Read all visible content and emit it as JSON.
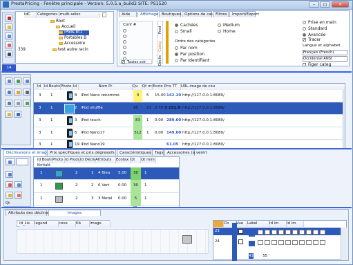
{
  "window": {
    "title": "PrestaPricing - Fenêtre principale - Version: 5.0.5.a_build2 SITE: PS1520"
  },
  "top_left": {
    "category_headers": [
      "IdC",
      "Catégories (multi-sélec"
    ],
    "category_rows": [
      {
        "id": "",
        "label": "Root"
      },
      {
        "id": "",
        "label": "Accueil"
      },
      {
        "id": "",
        "label": "iPods bt1"
      },
      {
        "id": "",
        "label": "Portables B"
      },
      {
        "id": "",
        "label": "Accessoire"
      },
      {
        "id": "339",
        "label": "test autre racin"
      }
    ],
    "number_label": "14"
  },
  "options": {
    "tabs": [
      "Aide",
      "Affichage",
      "Boutiques",
      "Options de calcul",
      "Filtres",
      "Import/Export"
    ],
    "conf_title": "Conf #",
    "conf_radio_count": 6,
    "side_tabs": [
      "Prod",
      "Catég",
      "Déclis"
    ],
    "size_options": [
      "Cachées",
      "Medium",
      "Small",
      "Home"
    ],
    "order_title": "Ordre des catégories",
    "order_options": [
      "Par nom",
      "Par position",
      "Par Identifiant"
    ],
    "mode_options": [
      "Prise en main",
      "Standard",
      "Avancée"
    ],
    "tracer_label": "Tracer",
    "language_title": "Langue et alphabet",
    "language_value": "Français (French)",
    "alphabet_value": "Occidental ANSI",
    "freeze_label": "Figer categ",
    "tout_label": "Toutes voir"
  },
  "products": {
    "headers": [
      "Id",
      "Id Boutiq",
      "Photo",
      "Id I",
      "Nom Pr",
      "Qu",
      "Qt mi",
      "Ecots",
      "Prix TT",
      "URL image de cou"
    ],
    "rows": [
      {
        "id": "3",
        "shop": "1",
        "idI": "8",
        "name": "iPod Nano renommé",
        "qty": "0",
        "qty_min": "5",
        "eco": "15.00",
        "price": "142.20",
        "url": "http://127.0.0.1:8080/"
      },
      {
        "id": "3",
        "shop": "1",
        "idI": "2",
        "name": "iPod shuffle",
        "qty": "95",
        "qty_min": "27",
        "eco": "2.70",
        "price": "3 231.9",
        "url": "http://127.0.0.1:8080/"
      },
      {
        "id": "3",
        "shop": "1",
        "idI": "3",
        "name": "iPod touch",
        "qty": "83",
        "qty_min": "1",
        "eco": "0.00",
        "price": "289.00",
        "url": "http://127.0.0.1:8080/"
      },
      {
        "id": "3",
        "shop": "1",
        "idI": "6",
        "name": "iPod Nano17",
        "qty": "512",
        "qty_min": "1",
        "eco": "0.00",
        "price": "149.00",
        "url": "http://127.0.0.1:8080/"
      },
      {
        "id": "3",
        "shop": "1",
        "idI": "19",
        "name": "iPod Nano19",
        "qty": "",
        "qty_min": "",
        "eco": "",
        "price": "61.05",
        "url": "http://127.0.0.1:8080/"
      }
    ]
  },
  "declinaisons": {
    "tabs": [
      "Déclinaisons et images",
      "Prix spécifiques et prix dégressifs",
      "Caractéristiques",
      "Tags",
      "Accessoires (à venir)"
    ],
    "headers": [
      "Id Boutique",
      "Photo",
      "Id Produit",
      "Id Déclin",
      "Attributs",
      "Ecotax",
      "Qt",
      "Qt mini"
    ],
    "header_note": "Kontakt",
    "rows": [
      {
        "shop": "1",
        "product": "2",
        "declin": "1",
        "attr": "4 Bleu",
        "eco": "5.00",
        "qty": "30",
        "min": "1"
      },
      {
        "shop": "1",
        "product": "2",
        "declin": "2",
        "attr": "6 Vert",
        "eco": "0.00",
        "qty": "30",
        "min": "1"
      },
      {
        "shop": "1",
        "product": "2",
        "declin": "3",
        "attr": "3 Metal",
        "eco": "0.00",
        "qty": "5",
        "min": "1"
      }
    ],
    "total_qty": "95",
    "qt_label": "Qt"
  },
  "bottom": {
    "tabs": [
      "Attributs des déclinaisons",
      "Images"
    ],
    "headers": [
      "Id_Lis",
      "legend",
      "cove",
      "Kb",
      "image"
    ],
    "right_headers": [
      "Cb",
      "Vue",
      "Label",
      "Id im",
      "Id im"
    ],
    "right_rows": [
      "23",
      "24"
    ],
    "left_rows": [
      "43",
      "55"
    ]
  },
  "colors": {
    "accent": "#3f65d7",
    "yellow": "#fff27a",
    "green": "#7ed36e",
    "blue": "#2d59b9"
  }
}
